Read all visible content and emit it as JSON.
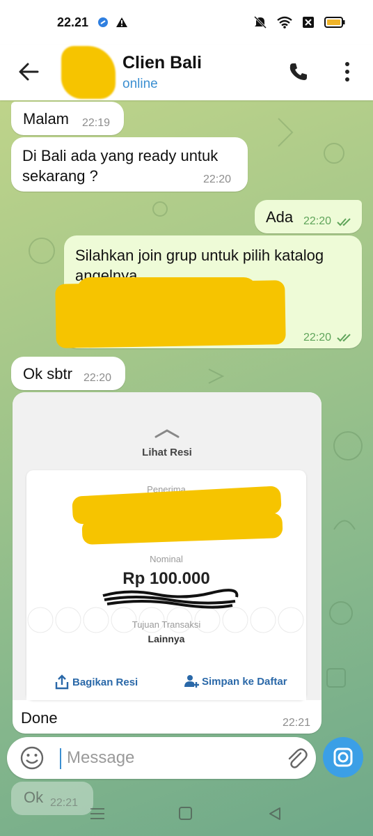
{
  "status_bar": {
    "time": "22.21"
  },
  "header": {
    "title": "Clien Bali",
    "status": "online"
  },
  "messages": [
    {
      "text": "Malam",
      "time": "22:19"
    },
    {
      "text1": "Di Bali ada yang ready untuk",
      "text2": "sekarang ?",
      "time": "22:20"
    },
    {
      "text": "Ada",
      "time": "22:20"
    },
    {
      "text1": "Silahkan join grup untuk pilih katalog",
      "text2": "angelnya",
      "time": "22:20"
    },
    {
      "text": "Ok sbtr",
      "time": "22:20"
    },
    {
      "text": "Done",
      "time": "22:21"
    }
  ],
  "receipt": {
    "title": "Lihat Resi",
    "recipient_label": "Penerima",
    "nominal_label": "Nominal",
    "amount": "Rp 100.000",
    "purpose_label": "Tujuan Transaksi",
    "purpose_value": "Lainnya",
    "share_label": "Bagikan Resi",
    "save_label": "Simpan ke Daftar"
  },
  "composer": {
    "placeholder": "Message"
  },
  "ghost_message": {
    "text": "Ok",
    "time": "22:21"
  }
}
